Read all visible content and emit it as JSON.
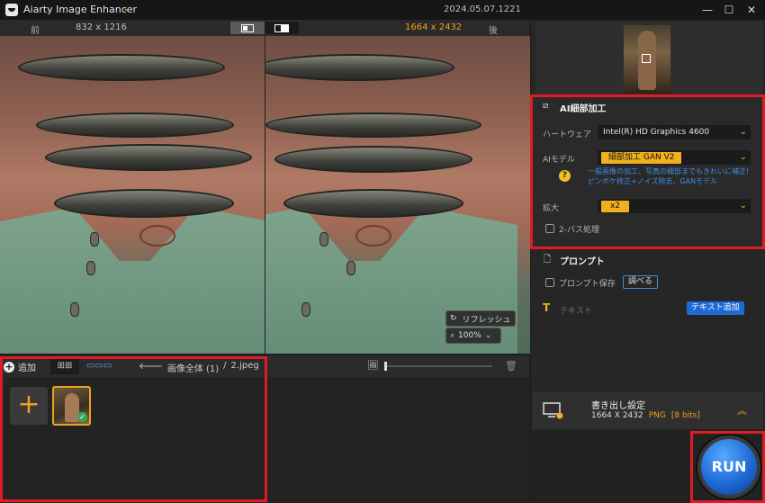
{
  "titlebar": {
    "app_name": "Aiarty Image Enhancer",
    "version": "2024.05.07.1221"
  },
  "compare": {
    "before_label": "前",
    "before_size": "832 x 1216",
    "after_size": "1664 x 2432",
    "after_label": "後"
  },
  "overlay": {
    "refresh_label": "リフレッシュ",
    "zoom_value": "100%"
  },
  "queue": {
    "add_label": "追加",
    "crumb_root": "画像全体 (1)",
    "crumb_sep": "/",
    "crumb_file": "2.jpeg",
    "grid_icon": "⊞⊞",
    "strip_icon": "▭▭▭"
  },
  "ai": {
    "title": "AI細部加工",
    "hardware_label": "ハートウェア",
    "hardware_value": "Intel(R) HD Graphics 4600",
    "model_label": "AIモデル",
    "model_value": "細部加工 GAN V2",
    "model_desc_line1": "一般画像の加工、写真の細部までもきれいに補正!",
    "model_desc_line2": "ピンボケ修正+ノイズ除去、GANモデル",
    "scale_label": "拡大",
    "scale_value": "x2",
    "twopass_label": "2-パス処理"
  },
  "prompt": {
    "title": "プロンプト",
    "save_label": "プロンプト保存",
    "lookup_label": "調べる",
    "text_placeholder": "テキスト",
    "add_text_label": "テキスト追加"
  },
  "export": {
    "title": "書き出し設定",
    "size": "1664 X 2432",
    "format": "PNG",
    "bits": "[8 bits]"
  },
  "run": {
    "label": "RUN"
  },
  "colors": {
    "accent": "#f0a020",
    "blue": "#1e6ad6",
    "highlight": "#e01b24"
  }
}
